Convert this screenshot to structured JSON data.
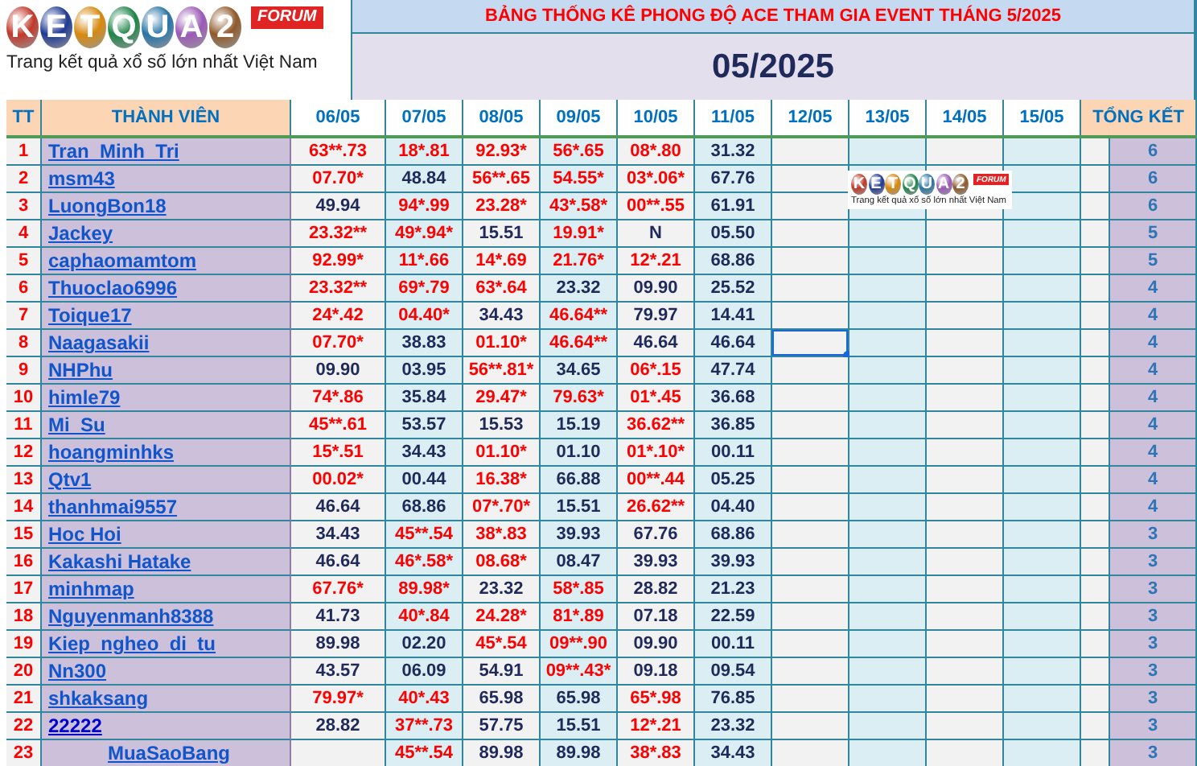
{
  "logo": {
    "letters": [
      "K",
      "E",
      "T",
      "Q",
      "U",
      "A",
      "2"
    ],
    "badge": "FORUM",
    "tagline": "Trang kết quả xổ số lớn nhất Việt Nam"
  },
  "banner": {
    "title": "BẢNG THỐNG KÊ PHONG ĐỘ ACE THAM GIA EVENT THÁNG 5/2025",
    "month": "05/2025"
  },
  "table": {
    "columns": {
      "index": "TT",
      "member": "THÀNH VIÊN",
      "days": [
        "06/05",
        "07/05",
        "08/05",
        "09/05",
        "10/05",
        "11/05",
        "12/05",
        "13/05",
        "14/05",
        "15/05"
      ],
      "total": "TỔNG KẾT"
    },
    "rows": [
      {
        "tt": "1",
        "name": "Tran_Minh_Tri",
        "visited": false,
        "selected": false,
        "total": "6",
        "cells": [
          {
            "value": "63**.73",
            "hit": true
          },
          {
            "value": "18*.81",
            "hit": true
          },
          {
            "value": "92.93*",
            "hit": true
          },
          {
            "value": "56*.65",
            "hit": true
          },
          {
            "value": "08*.80",
            "hit": true
          },
          {
            "value": "31.32",
            "hit": false
          }
        ]
      },
      {
        "tt": "2",
        "name": "msm43",
        "visited": false,
        "selected": false,
        "total": "6",
        "cells": [
          {
            "value": "07.70*",
            "hit": true
          },
          {
            "value": "48.84",
            "hit": false
          },
          {
            "value": "56**.65",
            "hit": true
          },
          {
            "value": "54.55*",
            "hit": true
          },
          {
            "value": "03*.06*",
            "hit": true
          },
          {
            "value": "67.76",
            "hit": false
          }
        ]
      },
      {
        "tt": "3",
        "name": "LuongBon18",
        "visited": false,
        "selected": false,
        "total": "6",
        "cells": [
          {
            "value": "49.94",
            "hit": false
          },
          {
            "value": "94*.99",
            "hit": true
          },
          {
            "value": "23.28*",
            "hit": true
          },
          {
            "value": "43*.58*",
            "hit": true
          },
          {
            "value": "00**.55",
            "hit": true
          },
          {
            "value": "61.91",
            "hit": false
          }
        ]
      },
      {
        "tt": "4",
        "name": "Jackey",
        "visited": false,
        "selected": false,
        "total": "5",
        "cells": [
          {
            "value": "23.32**",
            "hit": true
          },
          {
            "value": "49*.94*",
            "hit": true
          },
          {
            "value": "15.51",
            "hit": false
          },
          {
            "value": "19.91*",
            "hit": true
          },
          {
            "value": "N",
            "hit": false
          },
          {
            "value": "05.50",
            "hit": false
          }
        ]
      },
      {
        "tt": "5",
        "name": "caphaomamtom",
        "visited": false,
        "selected": false,
        "total": "5",
        "cells": [
          {
            "value": "92.99*",
            "hit": true
          },
          {
            "value": "11*.66",
            "hit": true
          },
          {
            "value": "14*.69",
            "hit": true
          },
          {
            "value": "21.76*",
            "hit": true
          },
          {
            "value": "12*.21",
            "hit": true
          },
          {
            "value": "68.86",
            "hit": false
          }
        ]
      },
      {
        "tt": "6",
        "name": "Thuoclao6996",
        "visited": false,
        "selected": false,
        "total": "4",
        "cells": [
          {
            "value": "23.32**",
            "hit": true
          },
          {
            "value": "69*.79",
            "hit": true
          },
          {
            "value": "63*.64",
            "hit": true
          },
          {
            "value": "23.32",
            "hit": false
          },
          {
            "value": "09.90",
            "hit": false
          },
          {
            "value": "25.52",
            "hit": false
          }
        ]
      },
      {
        "tt": "7",
        "name": "Toique17",
        "visited": false,
        "selected": false,
        "total": "4",
        "cells": [
          {
            "value": "24*.42",
            "hit": true
          },
          {
            "value": "04.40*",
            "hit": true
          },
          {
            "value": "34.43",
            "hit": false
          },
          {
            "value": "46.64**",
            "hit": true
          },
          {
            "value": "79.97",
            "hit": false
          },
          {
            "value": "14.41",
            "hit": false
          }
        ]
      },
      {
        "tt": "8",
        "name": "Naagasakii",
        "visited": false,
        "selected": true,
        "total": "4",
        "cells": [
          {
            "value": "07.70*",
            "hit": true
          },
          {
            "value": "38.83",
            "hit": false
          },
          {
            "value": "01.10*",
            "hit": true
          },
          {
            "value": "46.64**",
            "hit": true
          },
          {
            "value": "46.64",
            "hit": false
          },
          {
            "value": "46.64",
            "hit": false
          }
        ]
      },
      {
        "tt": "9",
        "name": "NHPhu",
        "visited": false,
        "selected": false,
        "total": "4",
        "cells": [
          {
            "value": "09.90",
            "hit": false
          },
          {
            "value": "03.95",
            "hit": false
          },
          {
            "value": "56**.81*",
            "hit": true
          },
          {
            "value": "34.65",
            "hit": false
          },
          {
            "value": "06*.15",
            "hit": true
          },
          {
            "value": "47.74",
            "hit": false
          }
        ]
      },
      {
        "tt": "10",
        "name": "himle79",
        "visited": false,
        "selected": false,
        "total": "4",
        "cells": [
          {
            "value": "74*.86",
            "hit": true
          },
          {
            "value": "35.84",
            "hit": false
          },
          {
            "value": "29.47*",
            "hit": true
          },
          {
            "value": "79.63*",
            "hit": true
          },
          {
            "value": "01*.45",
            "hit": true
          },
          {
            "value": "36.68",
            "hit": false
          }
        ]
      },
      {
        "tt": "11",
        "name": "Mi_Su",
        "visited": false,
        "selected": false,
        "total": "4",
        "cells": [
          {
            "value": "45**.61",
            "hit": true
          },
          {
            "value": "53.57",
            "hit": false
          },
          {
            "value": "15.53",
            "hit": false
          },
          {
            "value": "15.19",
            "hit": false
          },
          {
            "value": "36.62**",
            "hit": true
          },
          {
            "value": "36.85",
            "hit": false
          }
        ]
      },
      {
        "tt": "12",
        "name": "hoangminhks",
        "visited": false,
        "selected": false,
        "total": "4",
        "cells": [
          {
            "value": "15*.51",
            "hit": true
          },
          {
            "value": "34.43",
            "hit": false
          },
          {
            "value": "01.10*",
            "hit": true
          },
          {
            "value": "01.10",
            "hit": false
          },
          {
            "value": "01*.10*",
            "hit": true
          },
          {
            "value": "00.11",
            "hit": false
          }
        ]
      },
      {
        "tt": "13",
        "name": "Qtv1",
        "visited": false,
        "selected": false,
        "total": "4",
        "cells": [
          {
            "value": "00.02*",
            "hit": true
          },
          {
            "value": "00.44",
            "hit": false
          },
          {
            "value": "16.38*",
            "hit": true
          },
          {
            "value": "66.88",
            "hit": false
          },
          {
            "value": "00**.44",
            "hit": true
          },
          {
            "value": "05.25",
            "hit": false
          }
        ]
      },
      {
        "tt": "14",
        "name": "thanhmai9557",
        "visited": false,
        "selected": false,
        "total": "4",
        "cells": [
          {
            "value": "46.64",
            "hit": false
          },
          {
            "value": "68.86",
            "hit": false
          },
          {
            "value": "07*.70*",
            "hit": true
          },
          {
            "value": "15.51",
            "hit": false
          },
          {
            "value": "26.62**",
            "hit": true
          },
          {
            "value": "04.40",
            "hit": false
          }
        ]
      },
      {
        "tt": "15",
        "name": "Hoc Hoi",
        "visited": false,
        "selected": false,
        "total": "3",
        "cells": [
          {
            "value": "34.43",
            "hit": false
          },
          {
            "value": "45**.54",
            "hit": true
          },
          {
            "value": "38*.83",
            "hit": true
          },
          {
            "value": "39.93",
            "hit": false
          },
          {
            "value": "67.76",
            "hit": false
          },
          {
            "value": "68.86",
            "hit": false
          }
        ]
      },
      {
        "tt": "16",
        "name": "Kakashi Hatake",
        "visited": false,
        "selected": false,
        "total": "3",
        "cells": [
          {
            "value": "46.64",
            "hit": false
          },
          {
            "value": "46*.58*",
            "hit": true
          },
          {
            "value": "08.68*",
            "hit": true
          },
          {
            "value": "08.47",
            "hit": false
          },
          {
            "value": "39.93",
            "hit": false
          },
          {
            "value": "39.93",
            "hit": false
          }
        ]
      },
      {
        "tt": "17",
        "name": "minhmap",
        "visited": false,
        "selected": false,
        "total": "3",
        "cells": [
          {
            "value": "67.76*",
            "hit": true
          },
          {
            "value": "89.98*",
            "hit": true
          },
          {
            "value": "23.32",
            "hit": false
          },
          {
            "value": "58*.85",
            "hit": true
          },
          {
            "value": "28.82",
            "hit": false
          },
          {
            "value": "21.23",
            "hit": false
          }
        ]
      },
      {
        "tt": "18",
        "name": "Nguyenmanh8388",
        "visited": false,
        "selected": false,
        "total": "3",
        "cells": [
          {
            "value": "41.73",
            "hit": false
          },
          {
            "value": "40*.84",
            "hit": true
          },
          {
            "value": "24.28*",
            "hit": true
          },
          {
            "value": "81*.89",
            "hit": true
          },
          {
            "value": "07.18",
            "hit": false
          },
          {
            "value": "22.59",
            "hit": false
          }
        ]
      },
      {
        "tt": "19",
        "name": "Kiep_ngheo_di_tu",
        "visited": false,
        "selected": false,
        "total": "3",
        "cells": [
          {
            "value": "89.98",
            "hit": false
          },
          {
            "value": "02.20",
            "hit": false
          },
          {
            "value": "45*.54",
            "hit": true
          },
          {
            "value": "09**.90",
            "hit": true
          },
          {
            "value": "09.90",
            "hit": false
          },
          {
            "value": "00.11",
            "hit": false
          }
        ]
      },
      {
        "tt": "20",
        "name": "Nn300",
        "visited": false,
        "selected": false,
        "total": "3",
        "cells": [
          {
            "value": "43.57",
            "hit": false
          },
          {
            "value": "06.09",
            "hit": false
          },
          {
            "value": "54.91",
            "hit": false
          },
          {
            "value": "09**.43*",
            "hit": true
          },
          {
            "value": "09.18",
            "hit": false
          },
          {
            "value": "09.54",
            "hit": false
          }
        ]
      },
      {
        "tt": "21",
        "name": "shkaksang",
        "visited": false,
        "selected": false,
        "total": "3",
        "cells": [
          {
            "value": "79.97*",
            "hit": true
          },
          {
            "value": "40*.43",
            "hit": true
          },
          {
            "value": "65.98",
            "hit": false
          },
          {
            "value": "65.98",
            "hit": false
          },
          {
            "value": "65*.98",
            "hit": true
          },
          {
            "value": "76.85",
            "hit": false
          }
        ]
      },
      {
        "tt": "22",
        "name": "22222",
        "visited": true,
        "selected": false,
        "total": "3",
        "cells": [
          {
            "value": "28.82",
            "hit": false
          },
          {
            "value": "37**.73",
            "hit": true
          },
          {
            "value": "57.75",
            "hit": false
          },
          {
            "value": "15.51",
            "hit": false
          },
          {
            "value": "12*.21",
            "hit": true
          },
          {
            "value": "23.32",
            "hit": false
          }
        ]
      },
      {
        "tt": "23",
        "name": "MuaSaoBang",
        "visited": false,
        "selected": false,
        "total": "3",
        "cells": [
          null,
          {
            "value": "45**.54",
            "hit": true
          },
          {
            "value": "89.98",
            "hit": false
          },
          {
            "value": "89.98",
            "hit": false
          },
          {
            "value": "38*.83",
            "hit": true
          },
          {
            "value": "34.43",
            "hit": false
          }
        ]
      }
    ]
  },
  "overlay_logo": {
    "letters": [
      "K",
      "E",
      "T",
      "Q",
      "U",
      "A",
      "2"
    ],
    "badge": "FORUM",
    "tagline": "Trang kết quả xổ số lớn nhất Việt Nam"
  }
}
